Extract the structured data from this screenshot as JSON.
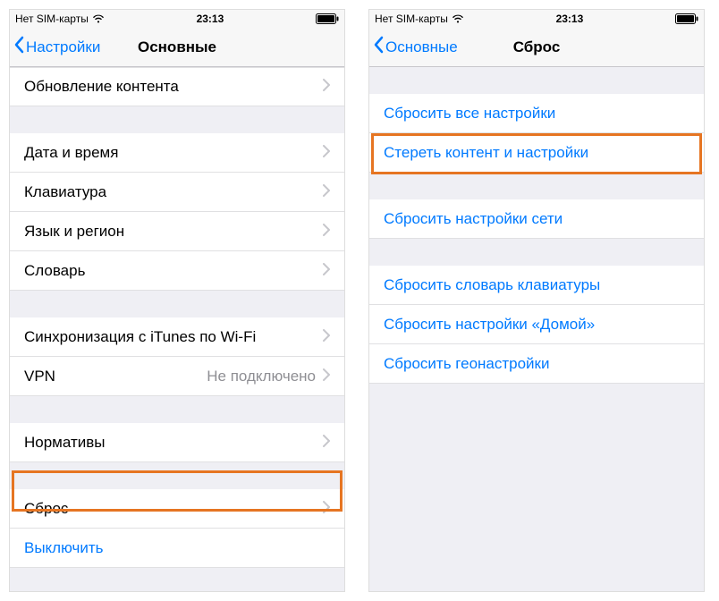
{
  "statusbar": {
    "carrier": "Нет SIM-карты",
    "time": "23:13"
  },
  "left": {
    "back": "Настройки",
    "title": "Основные",
    "rows": {
      "content_update": "Обновление контента",
      "date_time": "Дата и время",
      "keyboard": "Клавиатура",
      "lang_region": "Язык и регион",
      "dictionary": "Словарь",
      "itunes_wifi": "Синхронизация с iTunes по Wi-Fi",
      "vpn": "VPN",
      "vpn_status": "Не подключено",
      "regulatory": "Нормативы",
      "reset": "Сброс",
      "shutdown": "Выключить"
    }
  },
  "right": {
    "back": "Основные",
    "title": "Сброс",
    "rows": {
      "reset_all": "Сбросить все настройки",
      "erase_all": "Стереть контент и настройки",
      "reset_network": "Сбросить настройки сети",
      "reset_keyboard_dict": "Сбросить словарь клавиатуры",
      "reset_home": "Сбросить настройки «Домой»",
      "reset_location": "Сбросить геонастройки"
    }
  }
}
